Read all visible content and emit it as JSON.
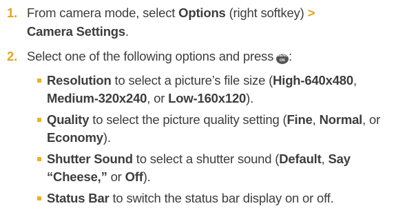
{
  "step1": {
    "number": "1.",
    "prefix": "From camera mode, select ",
    "options": "Options",
    "softkey": " (right softkey) ",
    "arrow": ">",
    "settings": "Camera Settings",
    "end": "."
  },
  "step2": {
    "number": "2.",
    "text": "Select one of the following options and press",
    "menu_top": "MENU",
    "menu_bottom": "OK",
    "end": ":"
  },
  "bullets": {
    "resolution": {
      "term": "Resolution",
      "desc": " to select a picture’s file size (",
      "high": "High-640x480",
      "sep1": ", ",
      "medium": "Medium-320x240",
      "sep2": ", or ",
      "low": "Low-160x120",
      "end": ")."
    },
    "quality": {
      "term": "Quality",
      "desc": " to select the picture quality setting (",
      "fine": "Fine",
      "sep1": ", ",
      "normal": "Normal",
      "sep2": ", or ",
      "economy": "Economy",
      "end": ")."
    },
    "shutter": {
      "term": "Shutter Sound",
      "desc": " to select a shutter sound (",
      "default": "Default",
      "sep1": ", ",
      "cheese": "Say “Cheese,”",
      "sep2": " or ",
      "off": "Off",
      "end": ")."
    },
    "status": {
      "term": "Status Bar",
      "desc": " to switch the status bar display on or off."
    }
  },
  "colors": {
    "accent": "#e8a317",
    "text": "#3d3d3d",
    "bullet": "#f2b01e",
    "menu_key": "#555555"
  },
  "icons": {
    "menu_key": "menu-ok-key-icon"
  }
}
